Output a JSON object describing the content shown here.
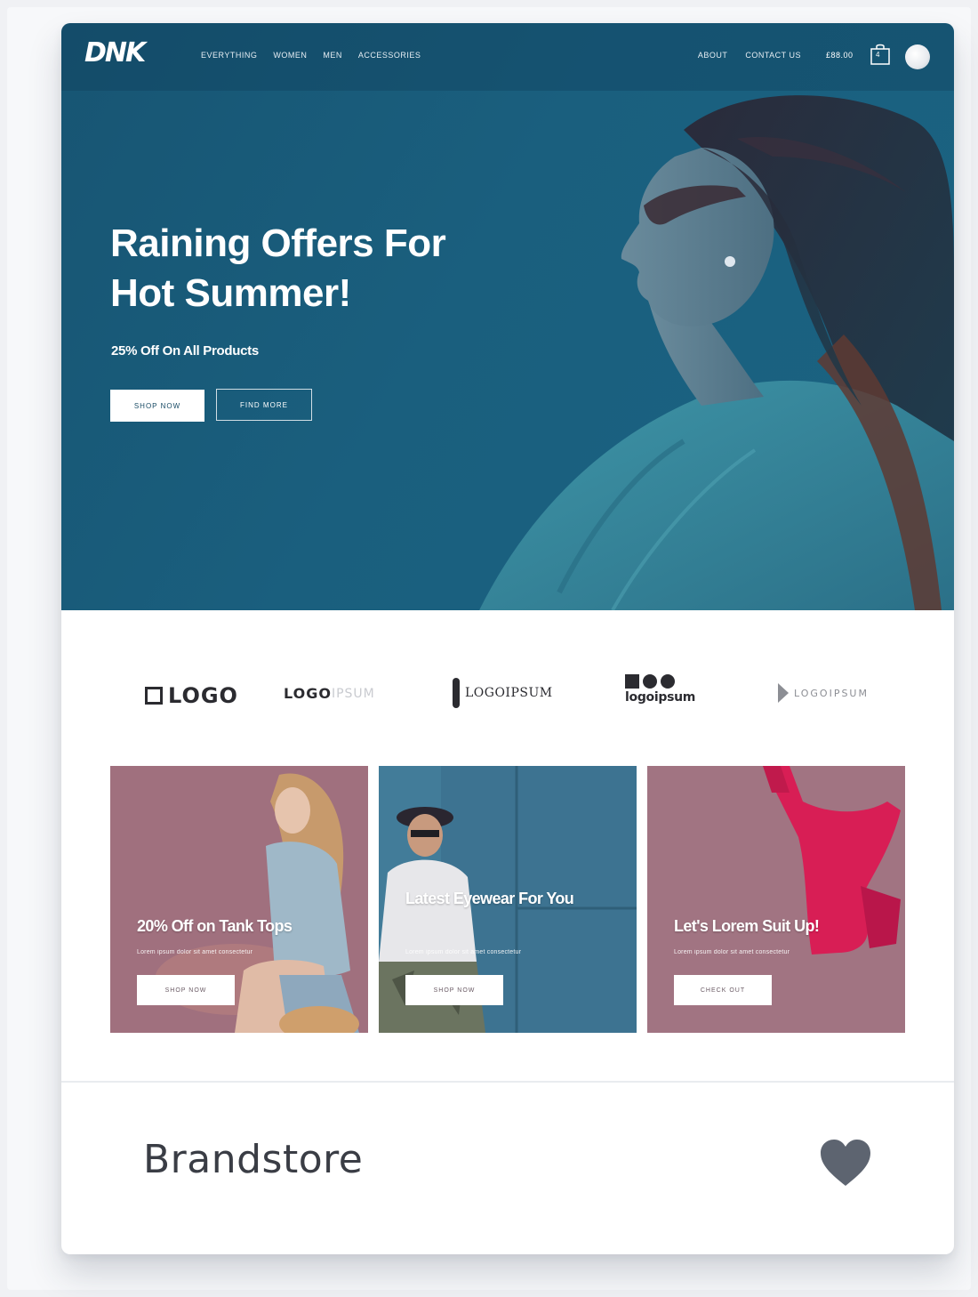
{
  "header": {
    "logo": "DNK",
    "nav_left": [
      "EVERYTHING",
      "WOMEN",
      "MEN",
      "ACCESSORIES"
    ],
    "nav_right": [
      "ABOUT",
      "CONTACT US"
    ],
    "cart_total": "£88.00",
    "cart_count": "4"
  },
  "hero": {
    "title": "Raining Offers For\nHot Summer!",
    "subtitle": "25% Off On All Products",
    "primary_button": "SHOP NOW",
    "secondary_button": "FIND MORE"
  },
  "brand_logos": [
    {
      "name": "logo-1",
      "text": "LOGO"
    },
    {
      "name": "logo-2",
      "text": "LOGO",
      "suffix": "IPSUM"
    },
    {
      "name": "logo-3",
      "text": "LOGOIPSUM"
    },
    {
      "name": "logo-4",
      "text": "logoipsum"
    },
    {
      "name": "logo-5",
      "text": "LOGOIPSUM"
    }
  ],
  "promos": [
    {
      "title": "20% Off on Tank Tops",
      "text": "Lorem ipsum dolor sit amet consectetur",
      "button": "SHOP NOW"
    },
    {
      "title": "Latest Eyewear For You",
      "text": "Lorem ipsum dolor sit amet consectetur",
      "button": "SHOP NOW"
    },
    {
      "title": "Let's Lorem Suit Up!",
      "text": "Lorem ipsum dolor sit amet consectetur",
      "button": "CHECK OUT"
    }
  ],
  "footer": {
    "title": "Brandstore"
  },
  "colors": {
    "hero_blue": "#1a5f7e",
    "promo_pink": "#9c6f7c",
    "promo_blue": "#3f7390",
    "heart_gray": "#5d6470"
  }
}
